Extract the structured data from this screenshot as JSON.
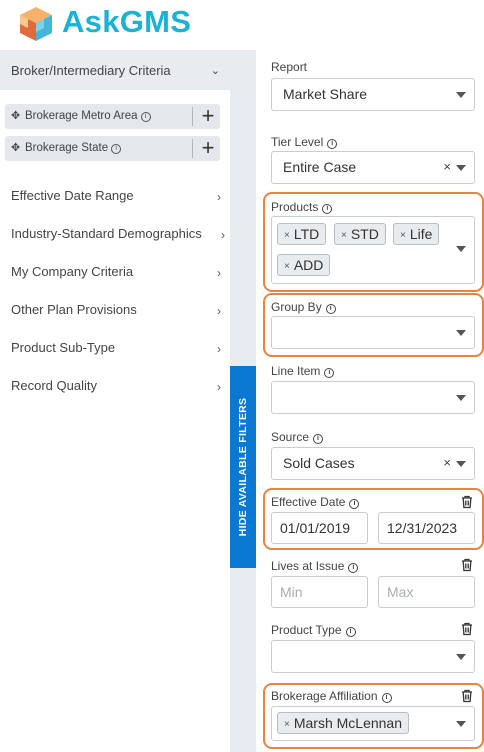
{
  "app": {
    "brand": "AskGMS",
    "logo_icon": "cube-logo-icon"
  },
  "sidebar": {
    "section_title": "Broker/Intermediary Criteria",
    "chips": [
      {
        "label": "Brokerage Metro Area"
      },
      {
        "label": "Brokerage State"
      }
    ],
    "nav_items": [
      {
        "label": "Effective Date Range"
      },
      {
        "label": "Industry-Standard Demographics"
      },
      {
        "label": "My Company Criteria"
      },
      {
        "label": "Other Plan Provisions"
      },
      {
        "label": "Product Sub-Type"
      },
      {
        "label": "Record Quality"
      }
    ]
  },
  "toggle_tab": {
    "label": "HIDE AVAILABLE FILTERS"
  },
  "filters": {
    "report": {
      "label": "Report",
      "value": "Market Share"
    },
    "tier_level": {
      "label": "Tier Level",
      "value": "Entire Case"
    },
    "products": {
      "label": "Products",
      "tags": [
        "LTD",
        "STD",
        "Life",
        "ADD"
      ]
    },
    "group_by": {
      "label": "Group By",
      "value": ""
    },
    "line_item": {
      "label": "Line Item",
      "value": ""
    },
    "source": {
      "label": "Source",
      "value": "Sold Cases"
    },
    "effective_date": {
      "label": "Effective Date",
      "from": "01/01/2019",
      "to": "12/31/2023"
    },
    "lives_at_issue": {
      "label": "Lives at Issue",
      "min_placeholder": "Min",
      "max_placeholder": "Max"
    },
    "product_type": {
      "label": "Product Type",
      "value": ""
    },
    "brokerage_affiliation": {
      "label": "Brokerage Affiliation",
      "tags": [
        "Marsh McLennan"
      ]
    }
  },
  "colors": {
    "brand": "#1ab3d6",
    "highlight": "#e8843e",
    "tab_blue": "#0b78d1"
  }
}
